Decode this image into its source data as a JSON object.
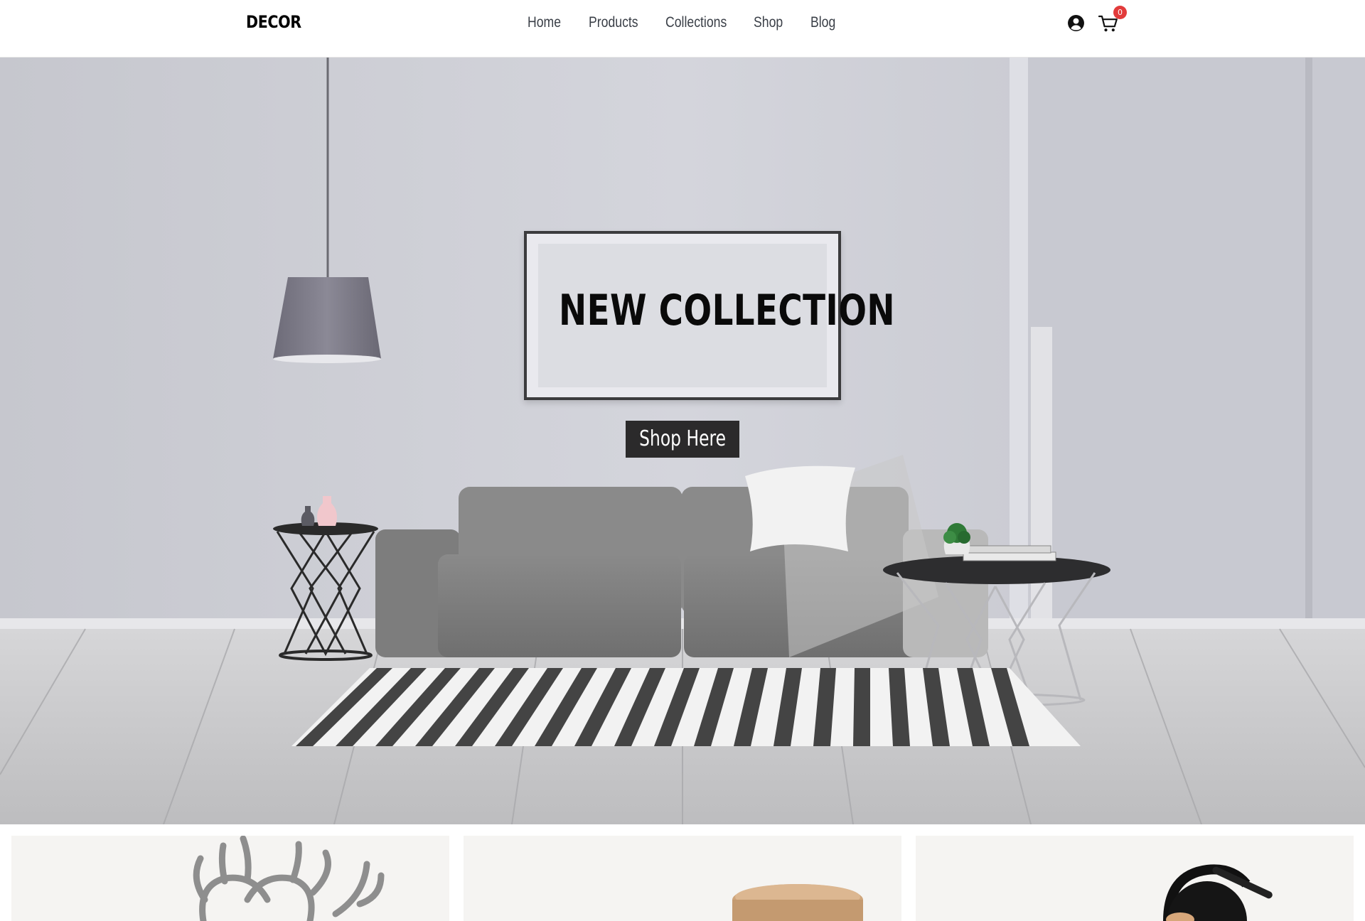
{
  "header": {
    "logo": "DECOR",
    "nav": [
      {
        "label": "Home"
      },
      {
        "label": "Products"
      },
      {
        "label": "Collections"
      },
      {
        "label": "Shop"
      },
      {
        "label": "Blog"
      }
    ],
    "user_icon": "user-circle-icon",
    "cart_icon": "shopping-cart-icon",
    "cart_count": "0"
  },
  "hero": {
    "title": "NEW COLLECTION",
    "cta_label": "Shop Here",
    "image": "living-room-scene"
  },
  "products": [
    {
      "image": "antler-decor"
    },
    {
      "image": "wooden-side-table"
    },
    {
      "image": "black-desk-lamp"
    }
  ],
  "colors": {
    "badge": "#e23b3b",
    "button_bg": "#2b2a2b",
    "card_bg": "#f5f4f2"
  }
}
